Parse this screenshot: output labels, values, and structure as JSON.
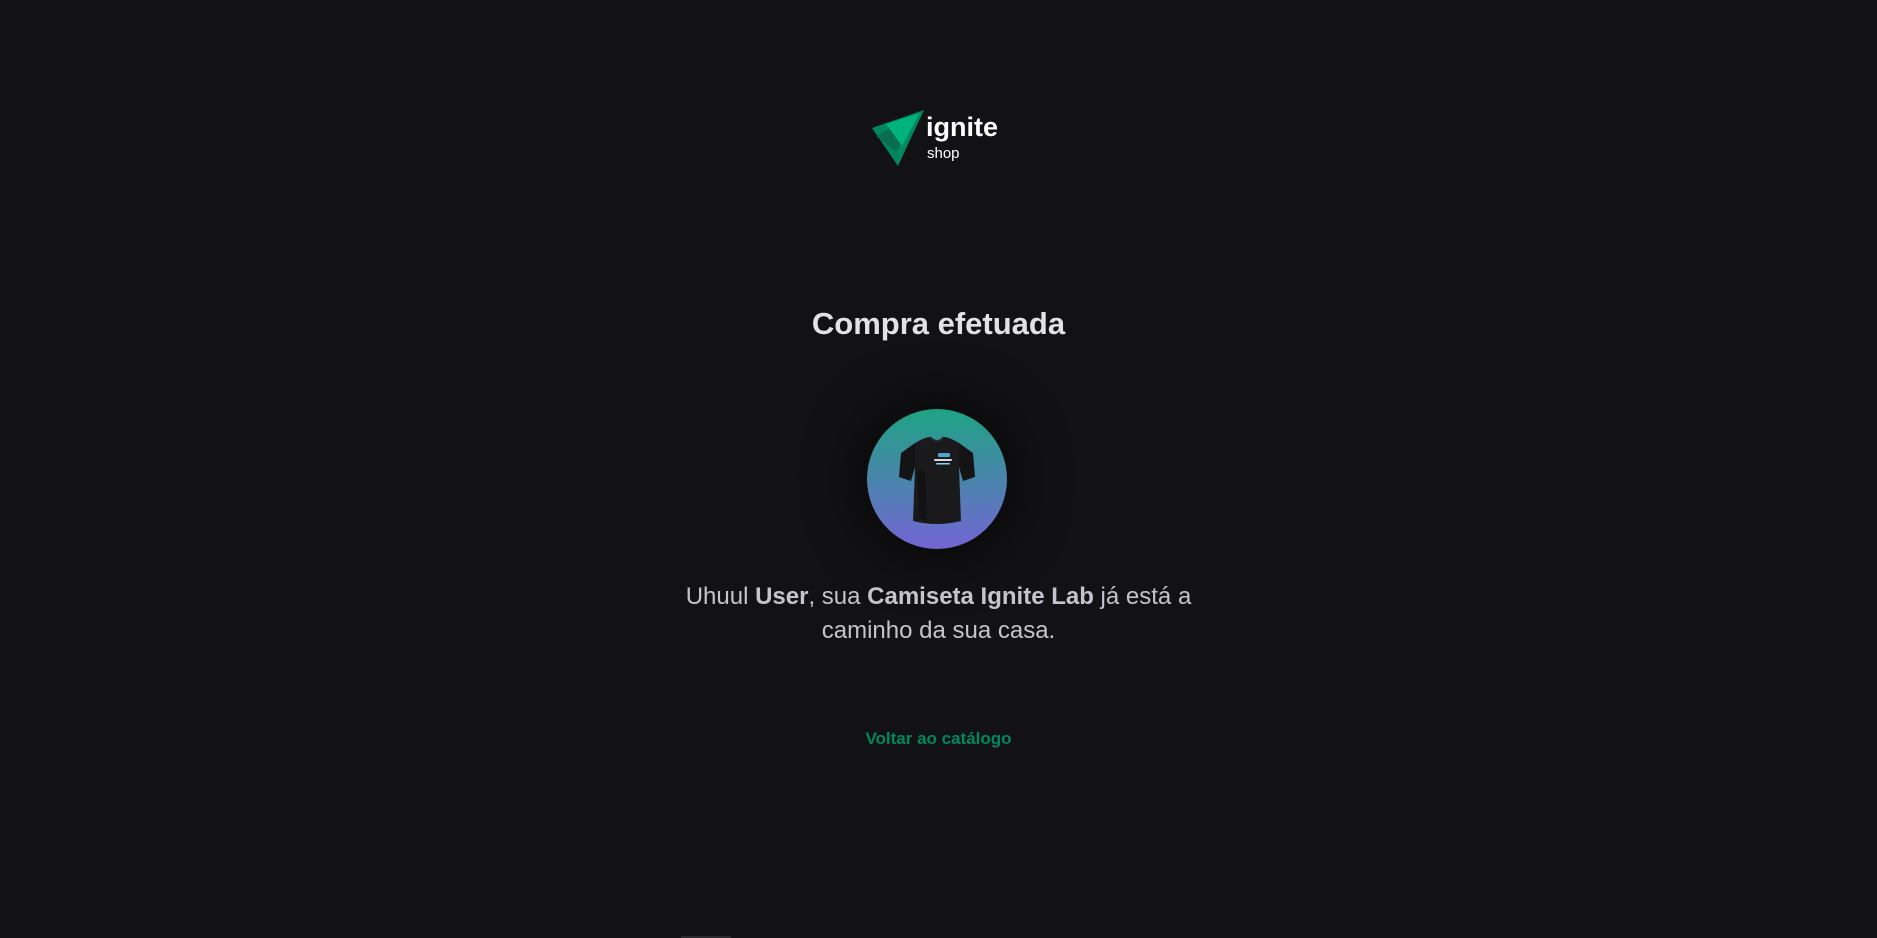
{
  "header": {
    "logo": {
      "title": "ignite",
      "subtitle": "shop",
      "colors": {
        "dark": "#00875f",
        "light": "#00b37e"
      }
    }
  },
  "main": {
    "title": "Compra efetuada",
    "product_image_icon": "t-shirt-image",
    "message": {
      "prefix": "Uhuul ",
      "user": "User",
      "middle": ", sua ",
      "product": "Camiseta Ignite Lab",
      "suffix": " já está a caminho da sua casa."
    },
    "back_link": "Voltar ao catálogo"
  },
  "colors": {
    "background": "#121214",
    "accent": "#00875f",
    "gradient_top": "#1ea483",
    "gradient_bottom": "#7465d4"
  }
}
